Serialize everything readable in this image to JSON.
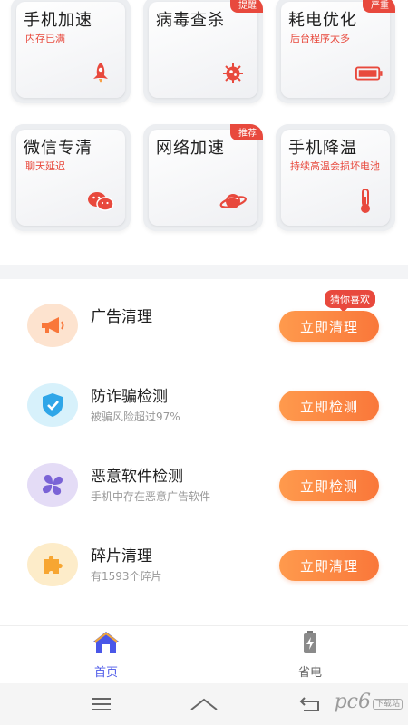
{
  "cards": [
    {
      "title": "手机加速",
      "subtitle": "内存已满",
      "tag": "",
      "icon": "rocket-icon"
    },
    {
      "title": "病毒查杀",
      "subtitle": "",
      "tag": "提醒",
      "icon": "virus-icon"
    },
    {
      "title": "耗电优化",
      "subtitle": "后台程序太多",
      "tag": "严重",
      "icon": "battery-icon"
    },
    {
      "title": "微信专清",
      "subtitle": "聊天延迟",
      "tag": "",
      "icon": "wechat-icon"
    },
    {
      "title": "网络加速",
      "subtitle": "",
      "tag": "推荐",
      "icon": "planet-icon"
    },
    {
      "title": "手机降温",
      "subtitle": "持续高温会损坏电池",
      "tag": "",
      "icon": "thermometer-icon"
    }
  ],
  "list": [
    {
      "name": "广告清理",
      "desc": "",
      "button": "立即清理",
      "icon": "megaphone-icon"
    },
    {
      "name": "防诈骗检测",
      "desc": "被骗风险超过97%",
      "button": "立即检测",
      "icon": "shield-check-icon"
    },
    {
      "name": "恶意软件检测",
      "desc": "手机中存在恶意广告软件",
      "button": "立即检测",
      "icon": "clover-icon"
    },
    {
      "name": "碎片清理",
      "desc": "有1593个碎片",
      "button": "立即清理",
      "icon": "puzzle-icon"
    }
  ],
  "badge": "猜你喜欢",
  "tabs": [
    {
      "label": "首页",
      "icon": "home-icon",
      "active": true
    },
    {
      "label": "省电",
      "icon": "battery-charge-icon",
      "active": false
    }
  ],
  "watermark": {
    "text": "pc6",
    "small": "下载站"
  },
  "colors": {
    "accent": "#f9773a",
    "tag": "#e8493d",
    "tab_active": "#4a57e8"
  }
}
